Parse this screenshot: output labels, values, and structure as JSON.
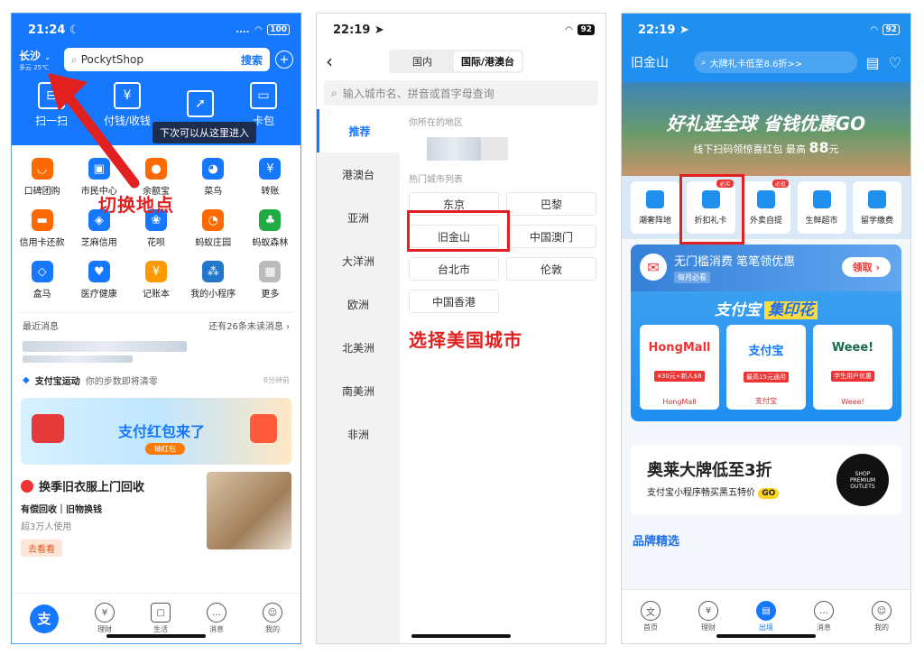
{
  "p1": {
    "time": "21:24 ☾",
    "battery": "100",
    "signal": "....",
    "location": "长沙",
    "weather": "多云 25℃",
    "search_text": "PockytShop",
    "search_btn": "搜索",
    "main_actions": [
      {
        "label": "扫一扫",
        "icon": "scan-icon"
      },
      {
        "label": "付钱/收钱",
        "icon": "pay-icon"
      },
      {
        "label": "",
        "icon": "send-icon"
      },
      {
        "label": "卡包",
        "icon": "card-icon"
      }
    ],
    "tooltip": "下次可以从这里进入",
    "grid": [
      {
        "label": "口碑团购",
        "icon": "koubei-icon",
        "color": "#ff6a00",
        "glyph": "◡"
      },
      {
        "label": "市民中心",
        "icon": "citizen-icon",
        "color": "#1677ff",
        "glyph": "▣"
      },
      {
        "label": "余额宝",
        "icon": "yuebao-icon",
        "color": "#ff6a00",
        "glyph": "●"
      },
      {
        "label": "菜鸟",
        "icon": "cainiao-icon",
        "color": "#1677ff",
        "glyph": "◕"
      },
      {
        "label": "转账",
        "icon": "transfer-icon",
        "color": "#1677ff",
        "glyph": "¥"
      },
      {
        "label": "信用卡还款",
        "icon": "credit-card-icon",
        "color": "#ff6a00",
        "glyph": "▬"
      },
      {
        "label": "芝麻信用",
        "icon": "zhima-icon",
        "color": "#1677ff",
        "glyph": "◈"
      },
      {
        "label": "花呗",
        "icon": "huabei-icon",
        "color": "#1677ff",
        "glyph": "❀"
      },
      {
        "label": "蚂蚁庄园",
        "icon": "chicken-icon",
        "color": "#ff6a00",
        "glyph": "◔"
      },
      {
        "label": "蚂蚁森林",
        "icon": "forest-icon",
        "color": "#22aa44",
        "glyph": "♣"
      },
      {
        "label": "盒马",
        "icon": "hema-icon",
        "color": "#1677ff",
        "glyph": "◇"
      },
      {
        "label": "医疗健康",
        "icon": "health-icon",
        "color": "#1677ff",
        "glyph": "♥"
      },
      {
        "label": "记账本",
        "icon": "ledger-icon",
        "color": "#ff9900",
        "glyph": "¥"
      },
      {
        "label": "我的小程序",
        "icon": "miniapp-icon",
        "color": "#2277cc",
        "glyph": "⁂"
      },
      {
        "label": "更多",
        "icon": "more-icon",
        "color": "#bbbbbb",
        "glyph": "▦"
      }
    ],
    "news_title": "最近消息",
    "news_unread": "还有26条未读消息 ›",
    "news_item": "支付宝运动",
    "news_item_text": "你的步数即将清零",
    "news_item_time": "8分钟前",
    "banner_title": "支付红包来了",
    "banner_btn": "抽红包",
    "recycle_title": "换季旧衣服上门回收",
    "recycle_sub": "有偿回收｜旧物换钱",
    "recycle_users": "超3万人使用",
    "recycle_btn": "去看看",
    "annotation": "切换地点",
    "tabs": [
      {
        "label": "",
        "icon": "alipay-home-icon"
      },
      {
        "label": "理财",
        "icon": "wealth-icon"
      },
      {
        "label": "生活",
        "icon": "life-icon"
      },
      {
        "label": "消息",
        "icon": "message-icon"
      },
      {
        "label": "我的",
        "icon": "profile-icon"
      }
    ]
  },
  "p2": {
    "time": "22:19 ➤",
    "battery": "92",
    "seg_domestic": "国内",
    "seg_intl": "国际/港澳台",
    "search_placeholder": "输入城市名、拼音或首字母查询",
    "regions": [
      "推荐",
      "港澳台",
      "亚洲",
      "大洋洲",
      "欧洲",
      "北美洲",
      "南美洲",
      "非洲"
    ],
    "current_label": "你所在的地区",
    "hot_label": "热门城市列表",
    "cities": [
      "东京",
      "巴黎",
      "旧金山",
      "中国澳门",
      "台北市",
      "伦敦",
      "中国香港"
    ],
    "annotation": "选择美国城市"
  },
  "p3": {
    "time": "22:19 ➤",
    "battery": "92",
    "city": "旧金山",
    "search_text": "大牌礼卡低至8.6折>>",
    "hero_title": "好礼逛全球 省钱优惠GO",
    "hero_sub": "线下扫码领惊喜红包 最高",
    "hero_amount": "88",
    "hero_unit": "元",
    "cats": [
      {
        "label": "潮奢阵地",
        "icon": "luxury-icon",
        "badge": ""
      },
      {
        "label": "折扣礼卡",
        "icon": "gift-card-icon",
        "badge": "必买"
      },
      {
        "label": "外卖自提",
        "icon": "takeout-icon",
        "badge": "必逛"
      },
      {
        "label": "生鲜超市",
        "icon": "supermarket-icon",
        "badge": ""
      },
      {
        "label": "留学缴费",
        "icon": "study-icon",
        "badge": ""
      }
    ],
    "promo_title": "无门槛消费 笔笔领优惠",
    "promo_sub": "每月必看",
    "promo_btn": "领取 ›",
    "stamp_title": "支付宝",
    "stamp_title2": "集印花",
    "stamp_cards": [
      {
        "brand": "HongMall",
        "tag": "¥30元+新人$8",
        "name": "HongMall"
      },
      {
        "brand": "支付宝",
        "tag": "最高15元通用",
        "name": "支付宝"
      },
      {
        "brand": "Weee!",
        "tag": "学生用户优惠",
        "name": "Weee!"
      }
    ],
    "outlet_title": "奥莱大牌低至3折",
    "outlet_sub": "支付宝小程序畅买黑五特价",
    "outlet_go": "GO",
    "outlet_logo": "SHOP PREMIUM OUTLETS",
    "brand_label": "品牌精选",
    "tabs": [
      {
        "label": "首页",
        "icon": "home-icon"
      },
      {
        "label": "理财",
        "icon": "wealth-icon"
      },
      {
        "label": "出境",
        "icon": "travel-icon"
      },
      {
        "label": "消息",
        "icon": "message-icon"
      },
      {
        "label": "我的",
        "icon": "profile-icon"
      }
    ]
  }
}
